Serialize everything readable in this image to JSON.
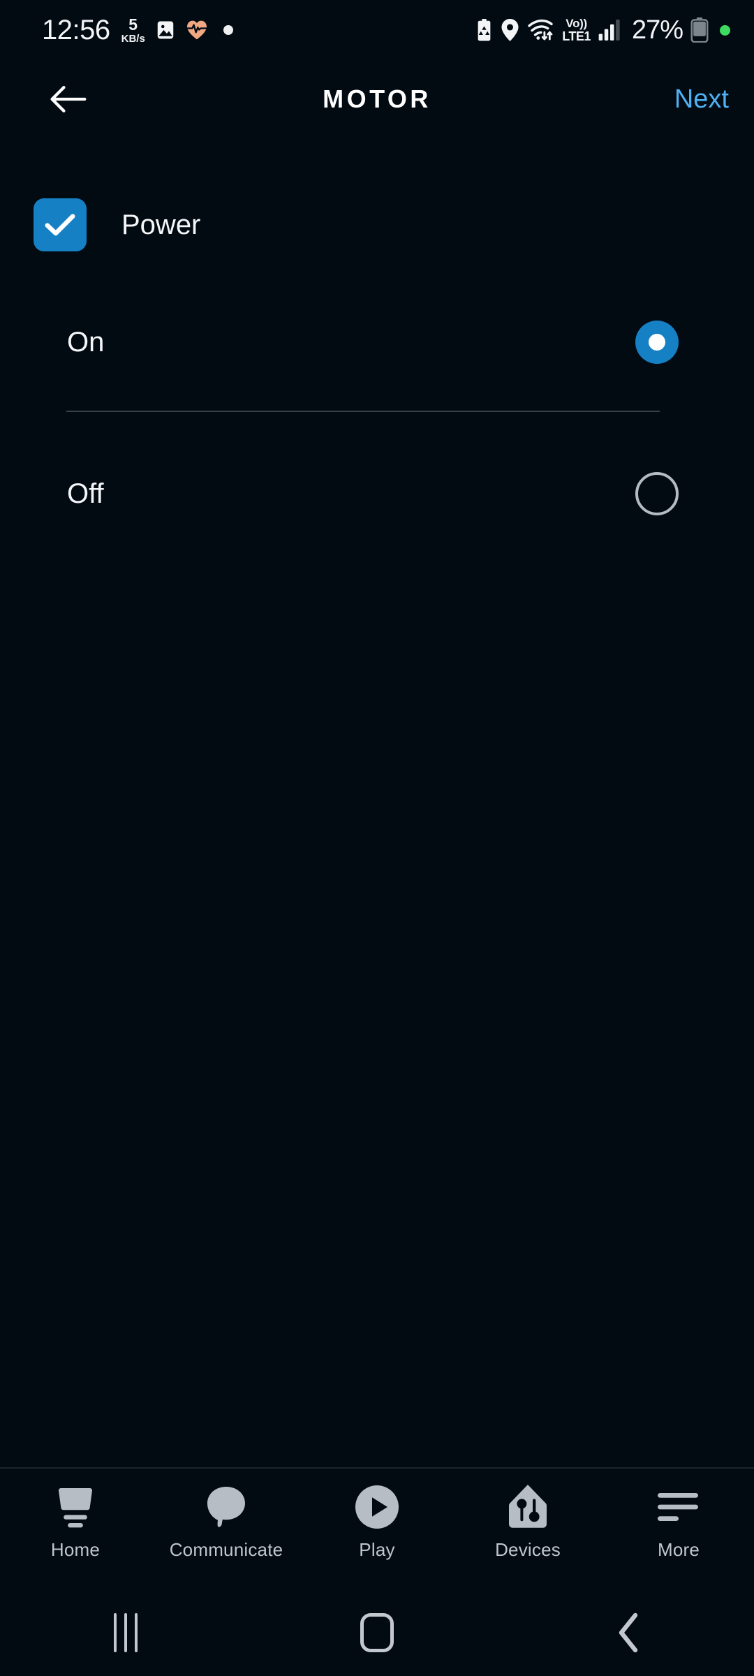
{
  "status_bar": {
    "time": "12:56",
    "net_speed_value": "5",
    "net_speed_unit": "KB/s",
    "icons_left": [
      "gallery-icon",
      "heart-rate-icon",
      "white-dot-indicator"
    ],
    "battery_saver": "battery-saver-icon",
    "location": "location-pin-icon",
    "wifi": "wifi-data-transfer-icon",
    "volte_top": "Vo))",
    "volte_bottom": "LTE1",
    "signal": "cellular-signal-icon",
    "battery_percent": "27%",
    "battery": "battery-icon",
    "green_dot": "camera-active-indicator"
  },
  "app_bar": {
    "back_label": "back-arrow",
    "title": "MOTOR",
    "next_label": "Next",
    "next_color": "#4FB0F2"
  },
  "content": {
    "group": {
      "label": "Power",
      "checked": true,
      "accent_color": "#1580C4"
    },
    "options": [
      {
        "label": "On",
        "selected": true
      },
      {
        "label": "Off",
        "selected": false
      }
    ]
  },
  "tab_bar": {
    "items": [
      {
        "label": "Home",
        "icon": "home-icon"
      },
      {
        "label": "Communicate",
        "icon": "speech-bubble-icon"
      },
      {
        "label": "Play",
        "icon": "play-circle-icon"
      },
      {
        "label": "Devices",
        "icon": "devices-house-icon"
      },
      {
        "label": "More",
        "icon": "menu-lines-icon"
      }
    ],
    "inactive_color": "#C0C6CC"
  },
  "nav_bar": {
    "recents": "recents-icon",
    "home": "home-square-icon",
    "back": "back-chevron-icon"
  },
  "theme": {
    "background": "#020A12",
    "accent": "#1580C4",
    "link": "#4FB0F2",
    "divider": "#3A4049"
  }
}
